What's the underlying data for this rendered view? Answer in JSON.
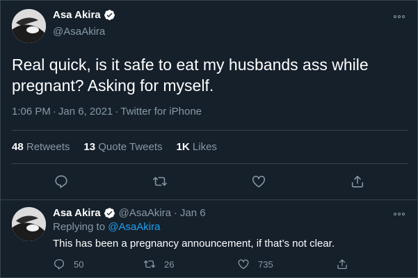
{
  "main_tweet": {
    "author": {
      "name": "Asa Akira",
      "handle": "@AsaAkira",
      "verified": true
    },
    "text": "Real quick, is it safe to eat my husbands ass while pregnant? Asking for myself.",
    "time": "1:06 PM",
    "date": "Jan 6, 2021",
    "source": "Twitter for iPhone",
    "stats": {
      "retweets_count": "48",
      "retweets_label": "Retweets",
      "quotes_count": "13",
      "quotes_label": "Quote Tweets",
      "likes_count": "1K",
      "likes_label": "Likes"
    },
    "icons": [
      "reply-icon",
      "retweet-icon",
      "like-icon",
      "share-icon"
    ]
  },
  "reply_tweet": {
    "author": {
      "name": "Asa Akira",
      "handle": "@AsaAkira",
      "verified": true
    },
    "date": "Jan 6",
    "replying_prefix": "Replying to",
    "replying_to": "@AsaAkira",
    "text": "This has been a pregnancy announcement, if that’s not clear.",
    "counts": {
      "replies": "50",
      "retweets": "26",
      "likes": "735"
    }
  },
  "colors": {
    "background": "#15202b",
    "border": "#38444d",
    "secondary_text": "#8899a6",
    "link": "#1da1f2"
  }
}
